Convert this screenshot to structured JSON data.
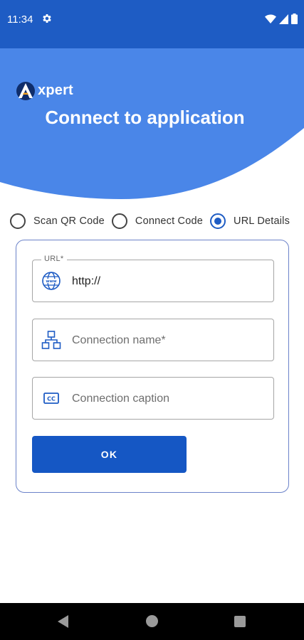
{
  "status_bar": {
    "time": "11:34",
    "icons": [
      "settings-gear-icon",
      "wifi-icon",
      "signal-icon",
      "battery-icon"
    ]
  },
  "header": {
    "brand": "xpert",
    "title": "Connect to application"
  },
  "connection_type": {
    "options": [
      {
        "label": "Scan QR Code",
        "selected": false
      },
      {
        "label": "Connect Code",
        "selected": false
      },
      {
        "label": "URL Details",
        "selected": true
      }
    ]
  },
  "form": {
    "url": {
      "label": "URL*",
      "value": "http://",
      "icon": "globe-icon"
    },
    "connection_name": {
      "placeholder": "Connection name*",
      "icon": "network-icon"
    },
    "connection_caption": {
      "placeholder": "Connection caption",
      "icon": "caption-icon"
    },
    "ok_label": "OK"
  },
  "colors": {
    "primary": "#1e5cc4",
    "header_blue": "#4a86e8",
    "button": "#1557c4"
  },
  "nav_bar": {
    "icons": [
      "back-icon",
      "home-icon",
      "recents-icon"
    ]
  }
}
